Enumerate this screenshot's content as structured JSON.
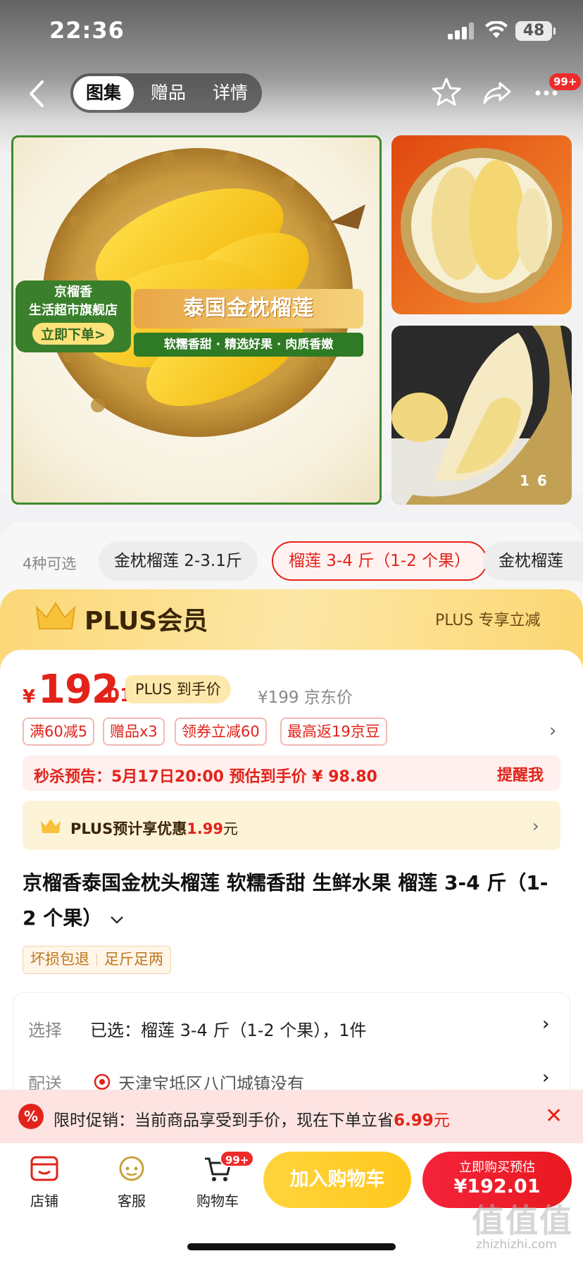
{
  "status_bar": {
    "time": "22:36",
    "battery": "48"
  },
  "nav": {
    "tabs": [
      {
        "label": "图集",
        "active": true
      },
      {
        "label": "赠品",
        "active": false
      },
      {
        "label": "详情",
        "active": false
      }
    ],
    "more_badge": "99+"
  },
  "gallery": {
    "store_name": "京榴香\n生活超市旗舰店",
    "store_button": "立即下单>",
    "banner_title": "泰国金枕榴莲",
    "banner_tags": "软糯香甜 · 精选好果 · 肉质香嫩",
    "counter": "1   6"
  },
  "sku": {
    "count_label": "4种可选",
    "options": [
      {
        "label": "金枕榴莲 2-3.1斤",
        "selected": false
      },
      {
        "label": "榴莲 3-4 斤（1-2 个果）",
        "selected": true
      },
      {
        "label": "金枕榴莲",
        "selected": false
      }
    ]
  },
  "plus": {
    "title": "PLUS会员",
    "right_text": "PLUS 专享立减"
  },
  "price": {
    "currency": "¥",
    "integer": "192",
    "decimal": ".01",
    "plus_tag": "PLUS 到手价",
    "jd_price": "¥199 京东价",
    "promo_tags": [
      "满60减5",
      "赠品x3",
      "领券立减60",
      "最高返19京豆"
    ],
    "flash_text": "秒杀预告：5月17日20:00 预估到手价 ¥ 98.80",
    "remind_label": "提醒我",
    "plus_save_prefix": "PLUS预计享优惠",
    "plus_save_amount": "1.99",
    "plus_save_suffix": "元"
  },
  "product": {
    "title": "京榴香泰国金枕头榴莲 软糯香甜 生鲜水果 榴莲 3-4 斤（1-2 个果）",
    "service_tags": [
      "坏损包退",
      "足斤足两"
    ]
  },
  "selection": {
    "select_label": "选择",
    "select_value": "已选：榴莲 3-4 斤（1-2 个果），1件",
    "ship_label": "配送",
    "ship_value": "天津宝坻区八门城镇没有"
  },
  "promo_strip": {
    "icon": "%",
    "text_prefix": "限时促销：当前商品享受到手价，现在下单立省",
    "amount": "6.99",
    "suffix": "元"
  },
  "bottom_bar": {
    "store_label": "店铺",
    "service_label": "客服",
    "cart_label": "购物车",
    "cart_badge": "99+",
    "add_cart": "加入购物车",
    "buy_line1": "立即购买预估",
    "buy_line2": "¥192.01"
  },
  "watermark": {
    "main": "值值值",
    "sub": "zhizhizhi.com"
  },
  "colors": {
    "accent_red": "#e2231a",
    "plus_gold": "#fbd776",
    "cart_yellow": "#ffc81e"
  }
}
